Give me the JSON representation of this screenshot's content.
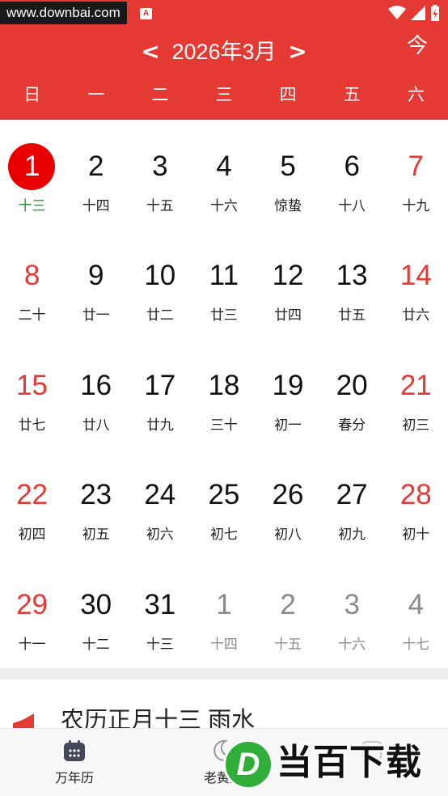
{
  "status_bar": {
    "watermark": "www.downbai.com",
    "badge": "A",
    "icons": [
      "wifi-icon",
      "signal-icon",
      "battery-charging-icon"
    ]
  },
  "header": {
    "prev_label": "<",
    "next_label": ">",
    "month_title": "2026年3月",
    "today_label": "今",
    "weekdays": [
      "日",
      "一",
      "二",
      "三",
      "四",
      "五",
      "六"
    ],
    "background_color": "#e53a33"
  },
  "calendar": {
    "weeks": [
      [
        {
          "day": "1",
          "lunar": "十三",
          "state": "today"
        },
        {
          "day": "2",
          "lunar": "十四",
          "state": "normal"
        },
        {
          "day": "3",
          "lunar": "十五",
          "state": "normal"
        },
        {
          "day": "4",
          "lunar": "十六",
          "state": "normal"
        },
        {
          "day": "5",
          "lunar": "惊蛰",
          "state": "normal"
        },
        {
          "day": "6",
          "lunar": "十八",
          "state": "normal"
        },
        {
          "day": "7",
          "lunar": "十九",
          "state": "weekend"
        }
      ],
      [
        {
          "day": "8",
          "lunar": "二十",
          "state": "weekend"
        },
        {
          "day": "9",
          "lunar": "廿一",
          "state": "normal"
        },
        {
          "day": "10",
          "lunar": "廿二",
          "state": "normal"
        },
        {
          "day": "11",
          "lunar": "廿三",
          "state": "normal"
        },
        {
          "day": "12",
          "lunar": "廿四",
          "state": "normal"
        },
        {
          "day": "13",
          "lunar": "廿五",
          "state": "normal"
        },
        {
          "day": "14",
          "lunar": "廿六",
          "state": "weekend"
        }
      ],
      [
        {
          "day": "15",
          "lunar": "廿七",
          "state": "weekend"
        },
        {
          "day": "16",
          "lunar": "廿八",
          "state": "normal"
        },
        {
          "day": "17",
          "lunar": "廿九",
          "state": "normal"
        },
        {
          "day": "18",
          "lunar": "三十",
          "state": "normal"
        },
        {
          "day": "19",
          "lunar": "初一",
          "state": "normal"
        },
        {
          "day": "20",
          "lunar": "春分",
          "state": "normal"
        },
        {
          "day": "21",
          "lunar": "初三",
          "state": "weekend"
        }
      ],
      [
        {
          "day": "22",
          "lunar": "初四",
          "state": "weekend"
        },
        {
          "day": "23",
          "lunar": "初五",
          "state": "normal"
        },
        {
          "day": "24",
          "lunar": "初六",
          "state": "normal"
        },
        {
          "day": "25",
          "lunar": "初七",
          "state": "normal"
        },
        {
          "day": "26",
          "lunar": "初八",
          "state": "normal"
        },
        {
          "day": "27",
          "lunar": "初九",
          "state": "normal"
        },
        {
          "day": "28",
          "lunar": "初十",
          "state": "weekend"
        }
      ],
      [
        {
          "day": "29",
          "lunar": "十一",
          "state": "weekend"
        },
        {
          "day": "30",
          "lunar": "十二",
          "state": "normal"
        },
        {
          "day": "31",
          "lunar": "十三",
          "state": "normal"
        },
        {
          "day": "1",
          "lunar": "十四",
          "state": "other"
        },
        {
          "day": "2",
          "lunar": "十五",
          "state": "other"
        },
        {
          "day": "3",
          "lunar": "十六",
          "state": "other"
        },
        {
          "day": "4",
          "lunar": "十七",
          "state": "other"
        }
      ]
    ],
    "weekend_color": "#e53a33",
    "today_circle_color": "#e80000",
    "today_lunar_color": "#1f8f2b",
    "other_month_color": "#8a8a8a"
  },
  "info_card": {
    "text": "农历正月十三 雨水",
    "icon": "red-flag-icon"
  },
  "bottom_nav": {
    "tabs": [
      {
        "label": "万年历",
        "icon": "calendar-icon"
      },
      {
        "label": "老黄历",
        "icon": "moon-icon"
      },
      {
        "label": "",
        "icon": "misc-icon"
      }
    ]
  },
  "overlay_logo": {
    "letter": "D",
    "text": "当百下载"
  }
}
